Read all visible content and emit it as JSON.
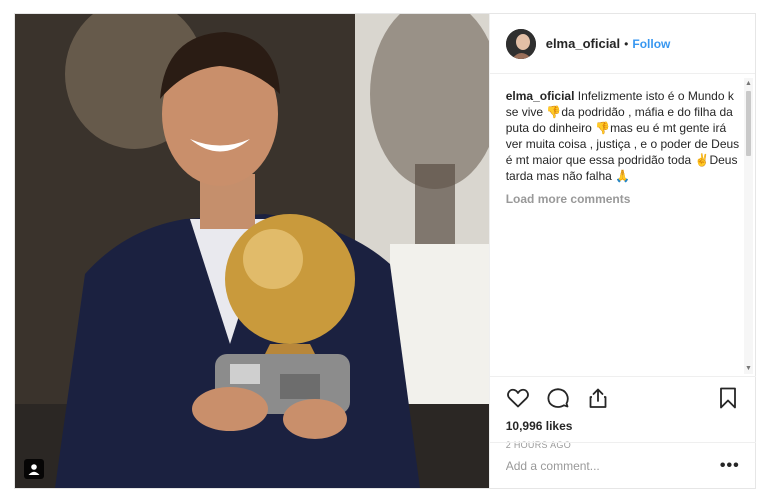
{
  "post": {
    "photo_alt": "",
    "tag_icon": "person-tag-icon"
  },
  "header": {
    "username": "elma_oficial",
    "separator": "•",
    "follow_label": "Follow"
  },
  "caption": {
    "username": "elma_oficial",
    "text": "Infelizmente isto é o Mundo k se vive 👎da podridão , máfia e do filha da puta do dinheiro 👎mas eu é mt gente irá ver muita coisa , justiça , e o poder de Deus é mt maior que essa podridão toda ✌️Deus tarda mas não falha 🙏"
  },
  "comments": {
    "load_more_label": "Load more comments"
  },
  "actions": {
    "icons": [
      "heart-icon",
      "comment-icon",
      "share-icon",
      "bookmark-icon"
    ],
    "likes": "10,996 likes",
    "timestamp": "2 HOURS AGO"
  },
  "comment_box": {
    "placeholder": "Add a comment...",
    "more_label": "•••"
  }
}
